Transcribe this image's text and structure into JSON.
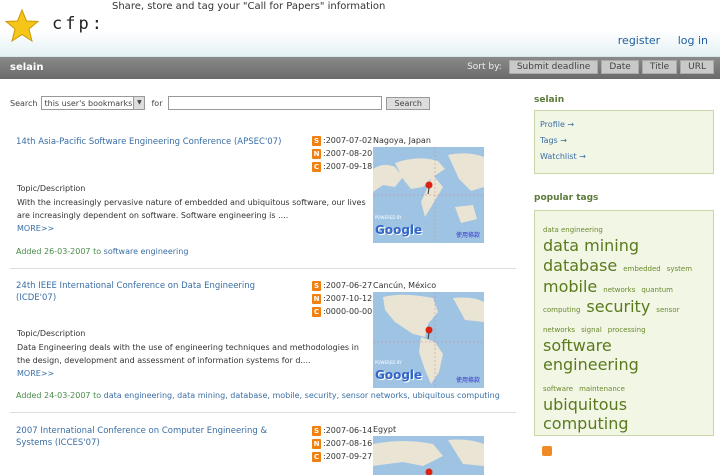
{
  "header": {
    "logo_text": "cfp:",
    "tagline": "Share, store and tag your \"Call for Papers\" information",
    "links": [
      "register",
      "log in"
    ]
  },
  "userbar": {
    "username": "selain",
    "sort_label": "Sort by:",
    "sort_buttons": [
      "Submit deadline",
      "Date",
      "Title",
      "URL"
    ]
  },
  "search": {
    "label": "Search",
    "select_value": "this user's bookmarks",
    "for_label": "for",
    "input_value": "",
    "button": "Search"
  },
  "entries": [
    {
      "title": "14th Asia-Pacific Software Engineering Conference (APSEC'07)",
      "s_date": ":2007-07-02",
      "n_date": ":2007-08-20",
      "c_date": ":2007-09-18",
      "place": "Nagoya, Japan",
      "topic": "Topic/Description",
      "desc": "With the increasingly pervasive nature of embedded and ubiquitous software, our lives are increasingly dependent on software. Software engineering is ....",
      "more": "MORE>>",
      "added": "Added 26-03-2007 to",
      "tags": "software engineering"
    },
    {
      "title": "24th IEEE International Conference on Data Engineering (ICDE'07)",
      "s_date": ":2007-06-27",
      "n_date": ":2007-10-12",
      "c_date": ":0000-00-00",
      "place": "Cancún, México",
      "topic": "Topic/Description",
      "desc": "Data Engineering deals with the use of engineering techniques and methodologies in the design, development and assessment of information systems for d....",
      "more": "MORE>>",
      "added": "Added 24-03-2007 to",
      "tags": "data engineering, data mining, database, mobile, security, sensor networks, ubiquitous computing"
    },
    {
      "title": "2007 International Conference on Computer Engineering & Systems (ICCES'07)",
      "s_date": ":2007-06-14",
      "n_date": ":2007-08-16",
      "c_date": ":2007-09-27",
      "place": "Egypt"
    }
  ],
  "badges": {
    "s": "S",
    "n": "N",
    "c": "C"
  },
  "map_labels": {
    "powered": "POWERED BY",
    "google": "Google",
    "terms": "使用條款"
  },
  "sidebar": {
    "user_heading": "selain",
    "links": [
      "Profile →",
      "Tags →",
      "Watchlist →"
    ],
    "tags_heading": "popular tags",
    "tags": [
      {
        "name": "data engineering",
        "size": 7
      },
      {
        "name": "data mining",
        "size": 16
      },
      {
        "name": "database",
        "size": 16
      },
      {
        "name": "embedded",
        "size": 7
      },
      {
        "name": "system",
        "size": 7
      },
      {
        "name": "mobile",
        "size": 16
      },
      {
        "name": "networks",
        "size": 7
      },
      {
        "name": "quantum",
        "size": 7
      },
      {
        "name": "computing",
        "size": 7
      },
      {
        "name": "security",
        "size": 16
      },
      {
        "name": "sensor",
        "size": 7
      },
      {
        "name": "networks",
        "size": 7
      },
      {
        "name": "signal",
        "size": 7
      },
      {
        "name": "processing",
        "size": 7
      },
      {
        "name": "software engineering",
        "size": 16
      },
      {
        "name": "software",
        "size": 7
      },
      {
        "name": "maintenance",
        "size": 7
      },
      {
        "name": "ubiquitous computing",
        "size": 16
      }
    ]
  },
  "colors": {
    "badge": "#f08010",
    "link": "#3a6ea5",
    "tag": "#6b8a2e",
    "sidebar_bg": "#f2f6e4"
  }
}
